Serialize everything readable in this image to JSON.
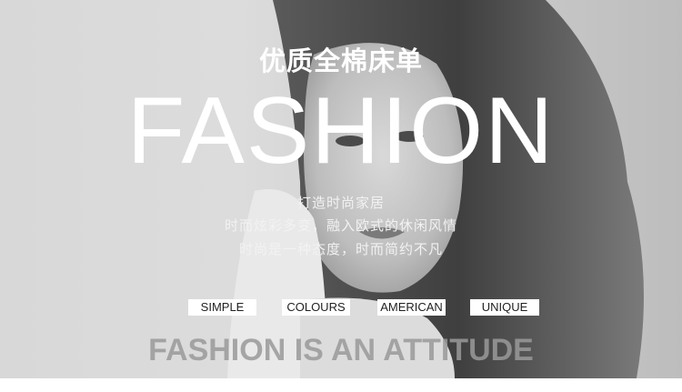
{
  "banner": {
    "title_cn": "优质全棉床单",
    "title_big": "FASHION",
    "desc_lines": [
      "打造时尚家居",
      "时而炫彩多变，融入欧式的休闲风情",
      "时尚是一种态度，时而简约不凡"
    ],
    "tags": [
      "SIMPLE",
      "COLOURS",
      "AMERICAN",
      "UNIQUE"
    ],
    "tagline": "FASHION IS AN ATTITUDE"
  },
  "colors": {
    "text_light": "#ffffff",
    "tag_bg": "#ffffff",
    "tagline": "#9a9a9a"
  }
}
